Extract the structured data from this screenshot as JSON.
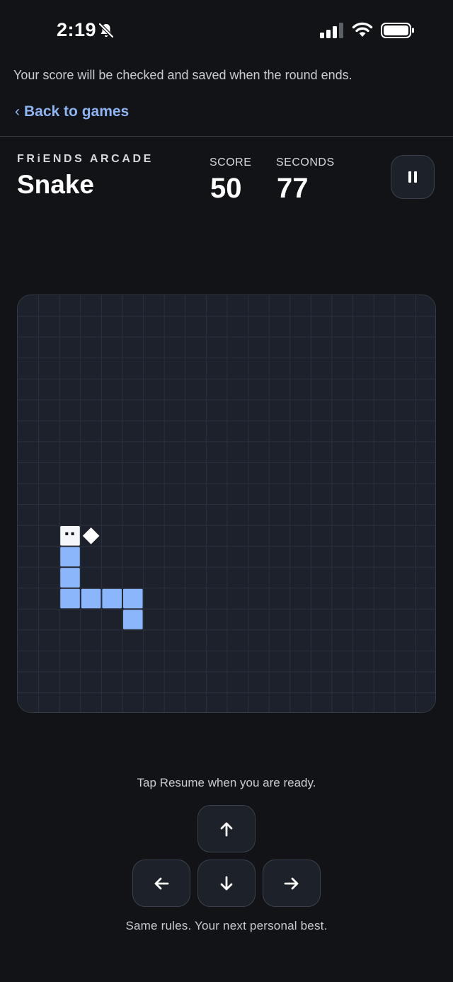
{
  "status": {
    "time": "2:19"
  },
  "notice": "Your score will be checked and saved when the round ends.",
  "nav": {
    "back_chevron": "‹",
    "back_label": "Back to games"
  },
  "header": {
    "brand": "FRiENDS ARCADE",
    "title": "Snake",
    "score_label": "SCORE",
    "score_value": "50",
    "seconds_label": "SECONDS",
    "seconds_value": "77",
    "pause_icon": "pause-icon"
  },
  "board": {
    "cols": 20,
    "rows": 20,
    "snake": [
      [
        2,
        11
      ],
      [
        2,
        12
      ],
      [
        2,
        13
      ],
      [
        2,
        14
      ],
      [
        3,
        14
      ],
      [
        4,
        14
      ],
      [
        5,
        14
      ],
      [
        5,
        15
      ]
    ],
    "food": [
      3,
      11
    ],
    "colors": {
      "background": "#1c212b",
      "grid": "#2b313c",
      "snake_body": "#8bb6fb",
      "snake_head": "#f4f6fa",
      "food": "#ffffff"
    }
  },
  "hint": "Tap Resume when you are ready.",
  "controls": {
    "up_icon": "arrow-up-icon",
    "left_icon": "arrow-left-icon",
    "down_icon": "arrow-down-icon",
    "right_icon": "arrow-right-icon"
  },
  "footer": "Same rules. Your next personal best.",
  "colors": {
    "accent": "#8fb4f2",
    "page_bg": "#111317"
  }
}
